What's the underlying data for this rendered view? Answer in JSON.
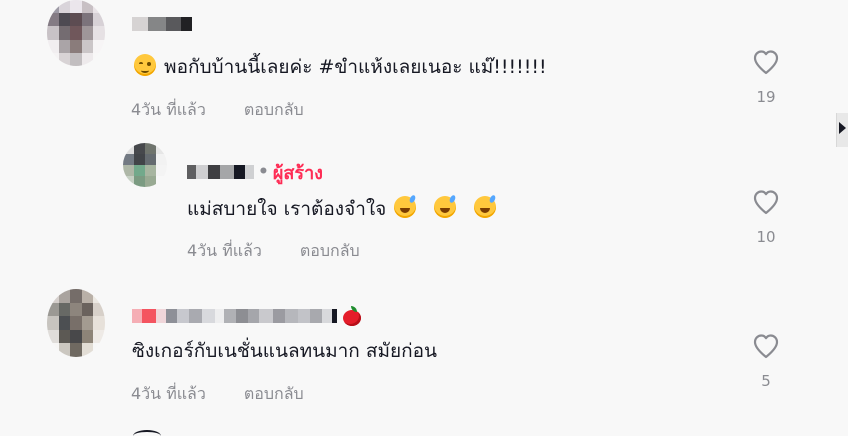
{
  "comments": [
    {
      "username": "",
      "text": "พอกับบ้านนี้เลยค่ะ #ขำแห้งเลยเนอะ แม๊!!!!!!!",
      "time": "4วัน ที่แล้ว",
      "reply": "ตอบกลับ",
      "likes": "19"
    },
    {
      "username": "",
      "creator_label": "ผู้สร้าง",
      "text": "แม่สบายใจ เราต้องจำใจ",
      "time": "4วัน ที่แล้ว",
      "reply": "ตอบกลับ",
      "likes": "10"
    },
    {
      "username": "",
      "text": "ซิงเกอร์กับเนชั่นแนลทนมาก สมัยก่อน",
      "time": "4วัน ที่แล้ว",
      "reply": "ตอบกลับ",
      "likes": "5"
    }
  ],
  "icons": {
    "like": "heart-icon",
    "emoji_first": "rolling-eyes-emoji-icon",
    "emoji_reply": "smiling-face-with-sweat-icon",
    "emoji_name": "apple-icon",
    "scroll": "scroll-arrow-icon"
  },
  "colors": {
    "background": "#f8f8f8",
    "text": "#161823",
    "muted": "#8a8b91",
    "creator": "#fe2c55"
  }
}
